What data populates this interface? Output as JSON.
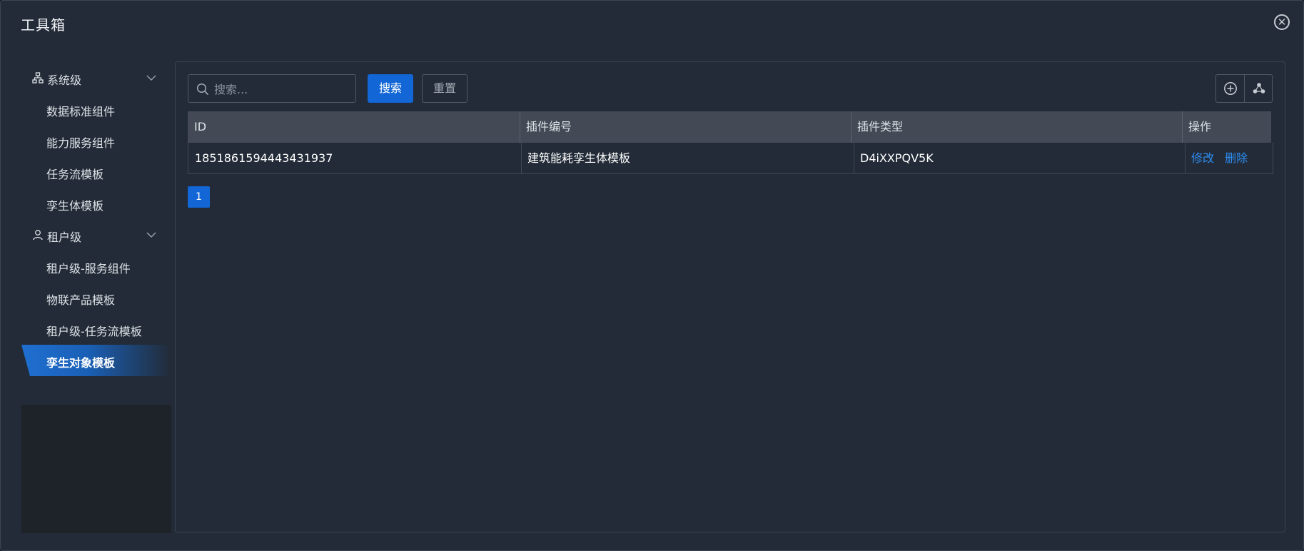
{
  "dialog": {
    "title": "工具箱"
  },
  "sidebar": {
    "groups": [
      {
        "label": "系统级",
        "icon": "sitemap-icon",
        "items": [
          {
            "label": "数据标准组件"
          },
          {
            "label": "能力服务组件"
          },
          {
            "label": "任务流模板"
          },
          {
            "label": "孪生体模板"
          }
        ]
      },
      {
        "label": "租户级",
        "icon": "user-icon",
        "items": [
          {
            "label": "租户级-服务组件"
          },
          {
            "label": "物联产品模板"
          },
          {
            "label": "租户级-任务流模板"
          },
          {
            "label": "孪生对象模板",
            "active": true
          }
        ]
      }
    ]
  },
  "toolbar": {
    "search_placeholder": "搜索...",
    "search_button": "搜索",
    "reset_button": "重置"
  },
  "table": {
    "columns": [
      "ID",
      "插件编号",
      "插件类型",
      "操作"
    ],
    "rows": [
      {
        "id": "1851861594443431937",
        "code": "建筑能耗孪生体模板",
        "type": "D4iXXPQV5K",
        "edit": "修改",
        "delete": "删除"
      }
    ]
  },
  "pagination": {
    "current": "1"
  },
  "colors": {
    "accent": "#1366d6",
    "link": "#2f8cf0",
    "background": "#222b37"
  }
}
